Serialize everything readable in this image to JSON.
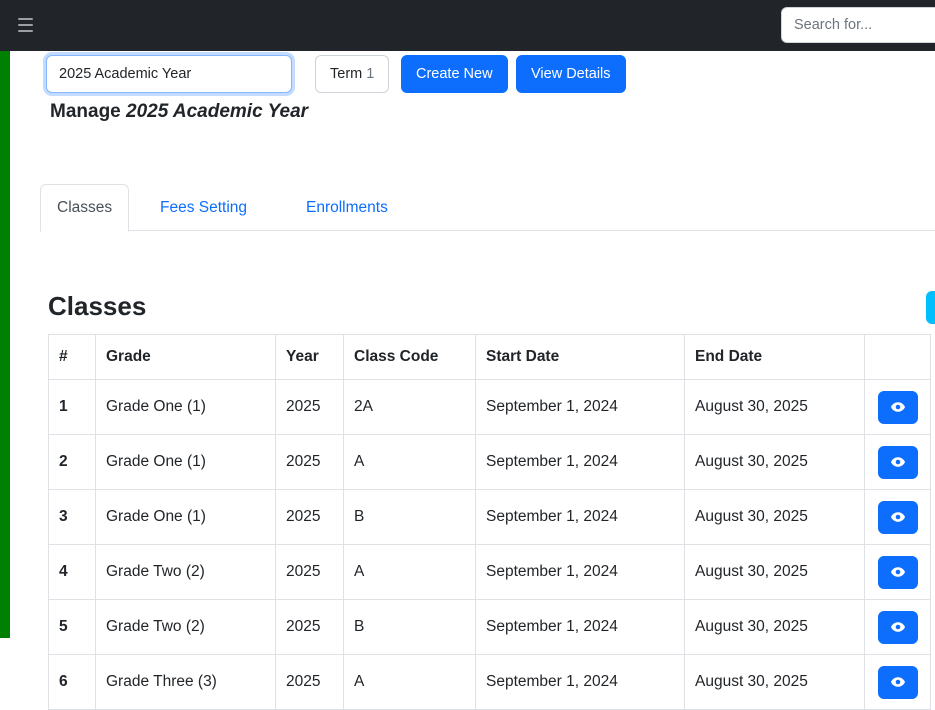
{
  "navbar": {
    "menu_icon": "hamburger-menu-icon",
    "search": {
      "value": "",
      "placeholder": "Search for..."
    }
  },
  "theme": {
    "navbar_bg": "#212529",
    "side_strip": "#008000",
    "primary": "#0d6efd",
    "link": "#0d6efd",
    "edge_pill": "#00bfff",
    "border": "#dee2e6",
    "focus_ring": "#86b7fe"
  },
  "toolbar": {
    "year_select_value": "2025 Academic Year",
    "term_label": "Term",
    "term_number": "1",
    "create_new_label": "Create New",
    "view_details_label": "View Details"
  },
  "page": {
    "heading_prefix": "Manage",
    "heading_emphasis": "2025 Academic Year",
    "section_title": "Classes"
  },
  "tabs": [
    {
      "label": "Classes",
      "active": true
    },
    {
      "label": "Fees Setting",
      "active": false
    },
    {
      "label": "Enrollments",
      "active": false
    }
  ],
  "table": {
    "columns": [
      "#",
      "Grade",
      "Year",
      "Class Code",
      "Start Date",
      "End Date",
      ""
    ],
    "action_icon": "eye-icon",
    "rows": [
      {
        "idx": "1",
        "grade": "Grade One (1)",
        "year": "2025",
        "code": "2A",
        "start": "September 1, 2024",
        "end": "August 30, 2025"
      },
      {
        "idx": "2",
        "grade": "Grade One (1)",
        "year": "2025",
        "code": "A",
        "start": "September 1, 2024",
        "end": "August 30, 2025"
      },
      {
        "idx": "3",
        "grade": "Grade One (1)",
        "year": "2025",
        "code": "B",
        "start": "September 1, 2024",
        "end": "August 30, 2025"
      },
      {
        "idx": "4",
        "grade": "Grade Two (2)",
        "year": "2025",
        "code": "A",
        "start": "September 1, 2024",
        "end": "August 30, 2025"
      },
      {
        "idx": "5",
        "grade": "Grade Two (2)",
        "year": "2025",
        "code": "B",
        "start": "September 1, 2024",
        "end": "August 30, 2025"
      },
      {
        "idx": "6",
        "grade": "Grade Three (3)",
        "year": "2025",
        "code": "A",
        "start": "September 1, 2024",
        "end": "August 30, 2025"
      }
    ]
  }
}
